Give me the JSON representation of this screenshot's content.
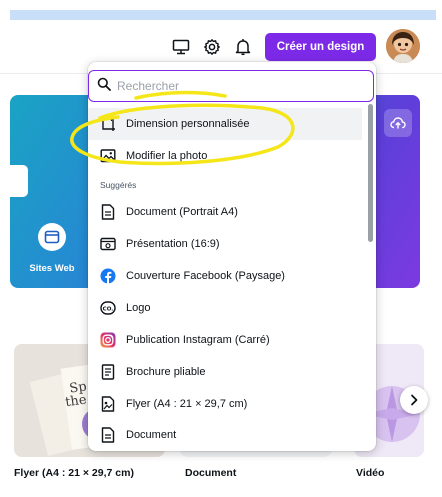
{
  "topbar": {
    "icons": [
      "monitor-icon",
      "gear-icon",
      "bell-icon"
    ],
    "create_label": "Créer un design"
  },
  "hero": {
    "site_label": "Sites Web",
    "gradient": [
      "#1aa3c4",
      "#2a7fd8",
      "#5c3fd9",
      "#7c3ae0"
    ]
  },
  "dropdown": {
    "search_placeholder": "Rechercher",
    "top_items": [
      {
        "label": "Dimension personnalisée",
        "icon": "custom-size-icon"
      },
      {
        "label": "Modifier la photo",
        "icon": "photo-edit-icon"
      }
    ],
    "section_label": "Suggérés",
    "suggested": [
      {
        "label": "Document (Portrait A4)",
        "icon": "document-icon"
      },
      {
        "label": "Présentation (16:9)",
        "icon": "presentation-icon"
      },
      {
        "label": "Couverture Facebook (Paysage)",
        "icon": "facebook-icon"
      },
      {
        "label": "Logo",
        "icon": "logo-icon"
      },
      {
        "label": "Publication Instagram (Carré)",
        "icon": "instagram-icon"
      },
      {
        "label": "Brochure pliable",
        "icon": "brochure-icon"
      },
      {
        "label": "Flyer (A4 : 21 × 29,7 cm)",
        "icon": "flyer-icon"
      },
      {
        "label": "Document",
        "icon": "document-icon"
      }
    ]
  },
  "cards": {
    "labels": [
      "Flyer (A4 : 21 × 29,7 cm)",
      "Document",
      "Vidéo"
    ]
  },
  "colors": {
    "accent": "#7d2ae8",
    "annotation": "#f5e61a",
    "facebook": "#1877f2"
  }
}
